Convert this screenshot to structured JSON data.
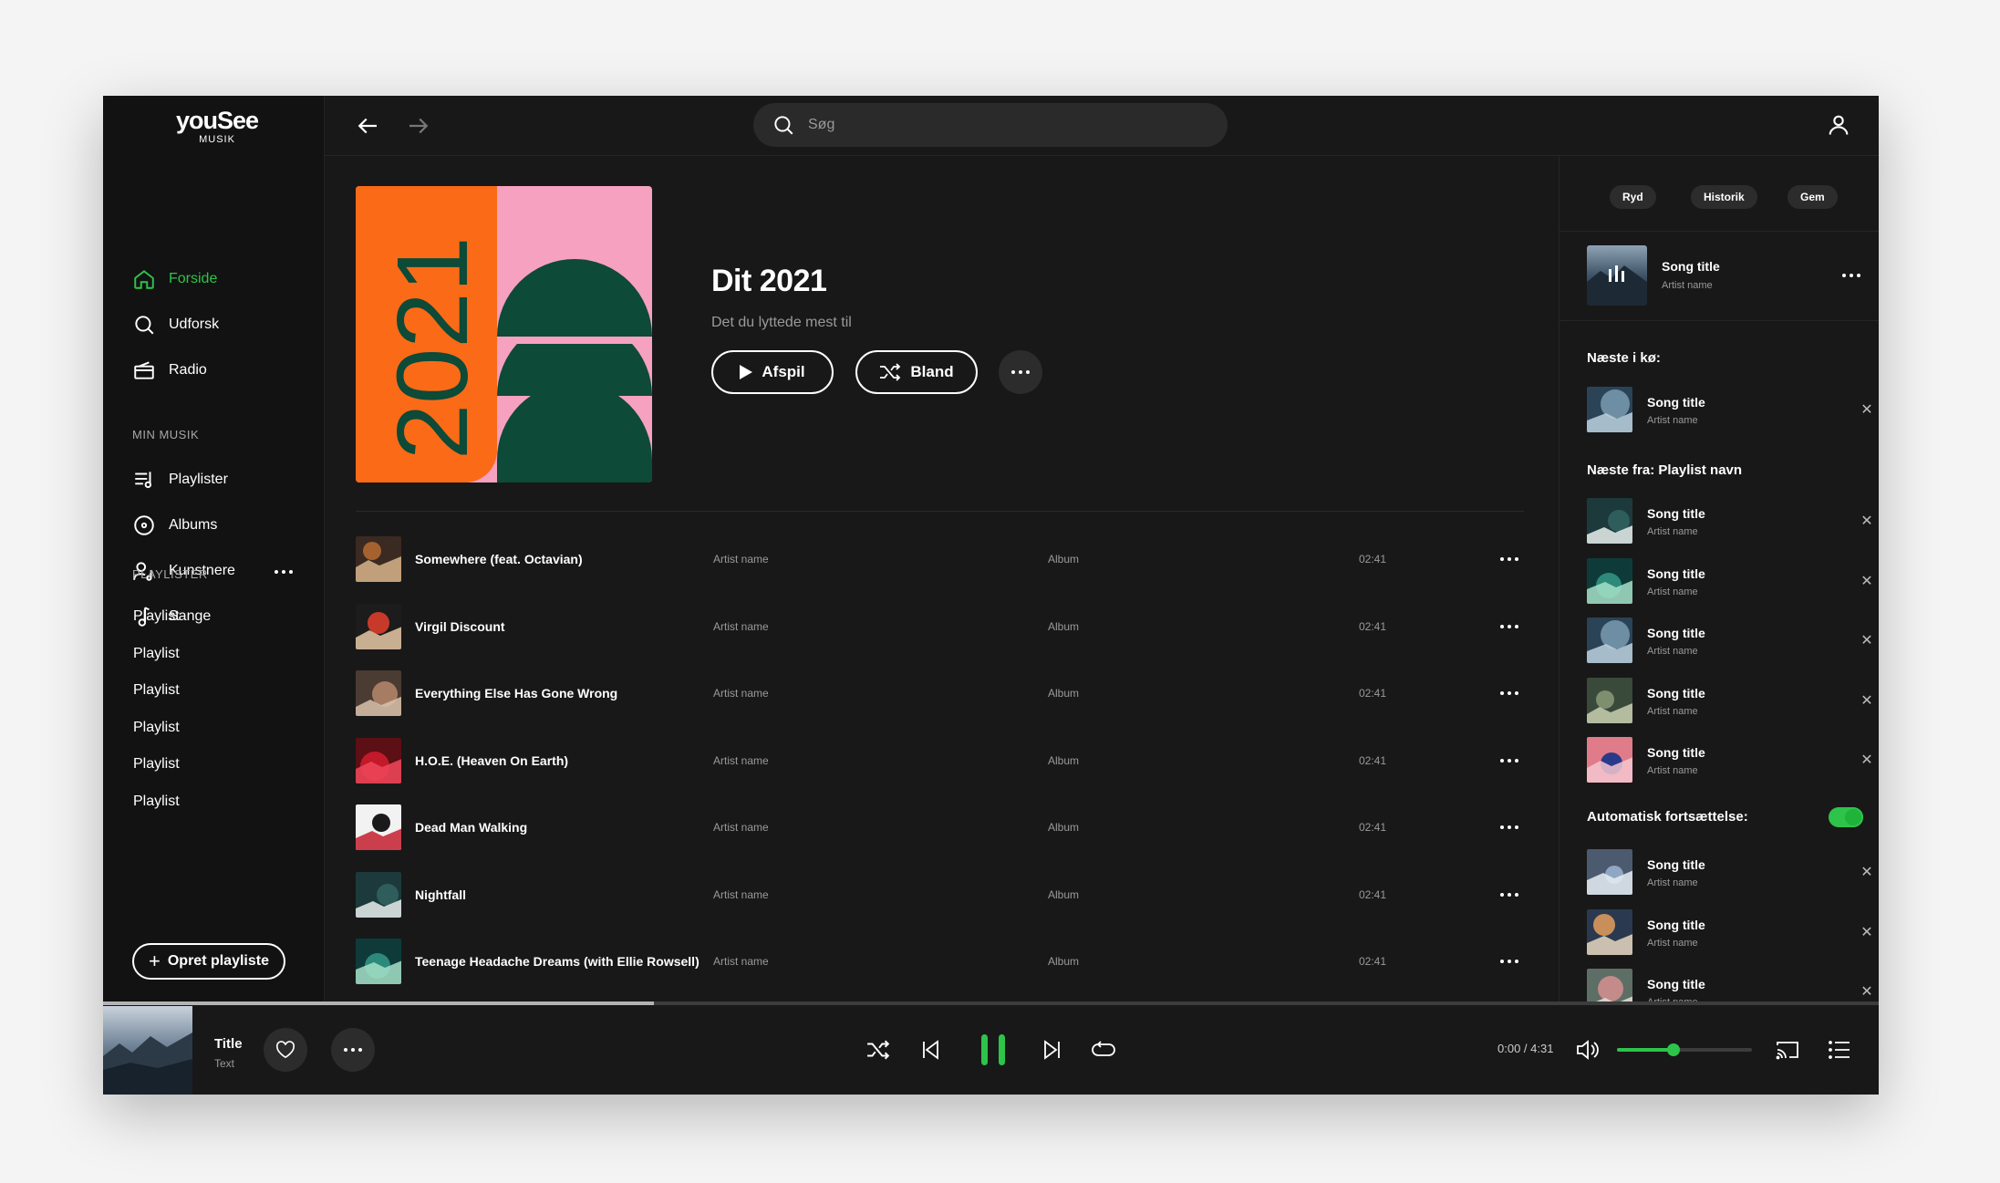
{
  "logo": {
    "brand": "youSee",
    "sub": "MUSIK"
  },
  "nav": [
    {
      "label": "Forside",
      "icon": "home-icon",
      "active": true
    },
    {
      "label": "Udforsk",
      "icon": "search-icon"
    },
    {
      "label": "Radio",
      "icon": "radio-icon"
    }
  ],
  "my_music": {
    "label": "MIN MUSIK",
    "items": [
      {
        "label": "Playlister",
        "icon": "playlist-icon"
      },
      {
        "label": "Albums",
        "icon": "album-icon"
      },
      {
        "label": "Kunstnere",
        "icon": "artist-icon"
      },
      {
        "label": "Sange",
        "icon": "music-note-icon"
      }
    ]
  },
  "playlists": {
    "label": "PLAYLISTER",
    "items": [
      "Playlist",
      "Playlist",
      "Playlist",
      "Playlist",
      "Playlist",
      "Playlist"
    ]
  },
  "create_playlist": "Opret playliste",
  "search": {
    "placeholder": "Søg"
  },
  "playlist_header": {
    "cover_text": "2021",
    "title": "Dit 2021",
    "subtitle": "Det du lyttede mest til",
    "play_label": "Afspil",
    "shuffle_label": "Bland"
  },
  "tracks": [
    {
      "title": "Somewhere (feat. Octavian)",
      "artist": "Artist name",
      "album": "Album",
      "duration": "02:41"
    },
    {
      "title": "Virgil Discount",
      "artist": "Artist name",
      "album": "Album",
      "duration": "02:41"
    },
    {
      "title": "Everything Else Has Gone Wrong",
      "artist": "Artist name",
      "album": "Album",
      "duration": "02:41"
    },
    {
      "title": "H.O.E. (Heaven On Earth)",
      "artist": "Artist name",
      "album": "Album",
      "duration": "02:41"
    },
    {
      "title": "Dead Man Walking",
      "artist": "Artist name",
      "album": "Album",
      "duration": "02:41"
    },
    {
      "title": "Nightfall",
      "artist": "Artist name",
      "album": "Album",
      "duration": "02:41"
    },
    {
      "title": "Teenage Headache Dreams (with Ellie Rowsell)",
      "artist": "Artist name",
      "album": "Album",
      "duration": "02:41"
    }
  ],
  "queue": {
    "pills": [
      "Ryd",
      "Historik",
      "Gem"
    ],
    "now_playing": {
      "title": "Song title",
      "artist": "Artist name"
    },
    "next_in_queue_label": "Næste i kø:",
    "next_in_queue": [
      {
        "title": "Song title",
        "artist": "Artist name"
      }
    ],
    "next_from_label": "Næste fra: Playlist navn",
    "next_from": [
      {
        "title": "Song title",
        "artist": "Artist name"
      },
      {
        "title": "Song title",
        "artist": "Artist name"
      },
      {
        "title": "Song title",
        "artist": "Artist name"
      },
      {
        "title": "Song title",
        "artist": "Artist name"
      },
      {
        "title": "Song title",
        "artist": "Artist name"
      }
    ],
    "autoplay_label": "Automatisk fortsættelse:",
    "autoplay_on": true,
    "autoplay": [
      {
        "title": "Song title",
        "artist": "Artist name"
      },
      {
        "title": "Song title",
        "artist": "Artist name"
      },
      {
        "title": "Song title",
        "artist": "Artist name"
      }
    ]
  },
  "player": {
    "title": "Title",
    "text": "Text",
    "time": "0:00 / 4:31",
    "progress_fraction": 0.31,
    "volume_fraction": 0.42
  },
  "colors": {
    "accent": "#2ec34a",
    "background": "#181818",
    "sidebar": "#121212"
  }
}
